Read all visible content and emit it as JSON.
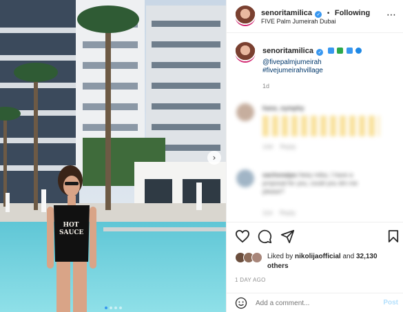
{
  "photo": {
    "shirt_text": [
      "HOT",
      "SAUCE"
    ],
    "next_icon": "chevron-right-icon",
    "slide_count": 4,
    "active_slide": 1
  },
  "header": {
    "username": "senoritamilica",
    "verified_icon": "verified-badge-icon",
    "separator": "•",
    "follow_status": "Following",
    "location": "FIVE Palm Jumeirah Dubai",
    "more_icon": "more-horizontal-icon"
  },
  "caption": {
    "username": "senoritamilica",
    "emojis": [
      "wave-emoji",
      "palm-tree-emoji",
      "wave-emoji",
      "wave-emoji"
    ],
    "mention": "@fivepalmjumeirah",
    "hashtag": "#fivejumeirahvillage",
    "time_ago": "1d"
  },
  "comments": [
    {
      "username": "hana_nymphy",
      "reply_label": "Reply",
      "time": "14d"
    },
    {
      "username": "sachsnaipa",
      "text": "Heey mika, I have a proposal for you, could you dm me please?",
      "reply_label": "Reply",
      "time": "11d"
    }
  ],
  "actions": {
    "like_icon": "heart-icon",
    "comment_icon": "comment-icon",
    "share_icon": "paper-plane-icon",
    "save_icon": "bookmark-icon"
  },
  "likes": {
    "prefix": "Liked by",
    "liker": "nikolijaofficial",
    "and": "and",
    "count": "32,130 others"
  },
  "timestamp": "1 DAY AGO",
  "add_comment": {
    "emoji_icon": "smiley-icon",
    "placeholder": "Add a comment...",
    "post_label": "Post"
  },
  "colors": {
    "accent_blue": "#3897f0",
    "post_button": "#b2dffc",
    "link_blue": "#00376b",
    "meta_gray": "#8e8e8e"
  }
}
